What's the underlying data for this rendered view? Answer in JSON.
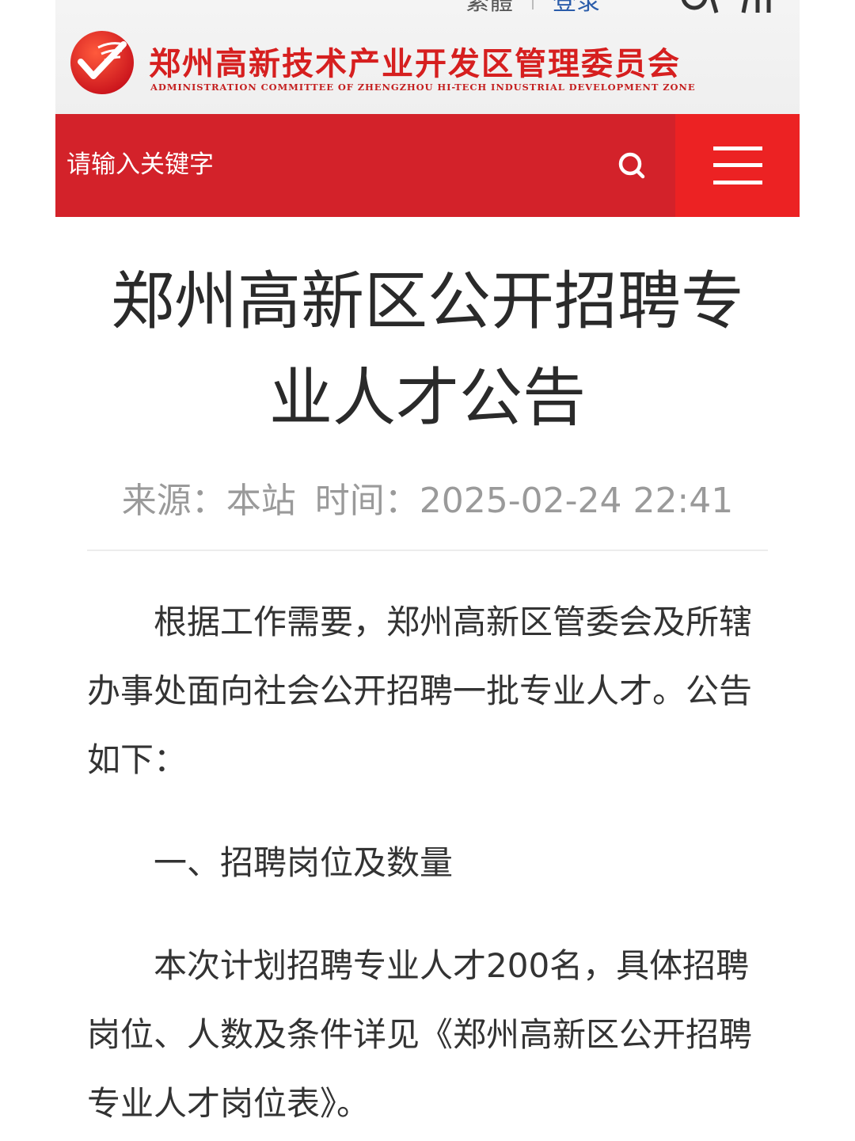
{
  "header": {
    "top_links": [
      "繁體",
      "登录"
    ],
    "icons": [
      "accessibility-icon",
      "elder-mode-icon"
    ],
    "logo_icon": "zhengzhou-hitech-logo",
    "org_name_cn": "郑州高新技术产业开发区管理委员会",
    "org_name_en": "ADMINISTRATION COMMITTEE OF ZHENGZHOU HI-TECH INDUSTRIAL DEVELOPMENT ZONE"
  },
  "search": {
    "placeholder": "请输入关键字",
    "search_icon": "search-icon",
    "menu_icon": "menu-icon"
  },
  "article": {
    "title": "郑州高新区公开招聘专业人才公告",
    "source_label": "来源：",
    "source": "本站",
    "time_label": "时间：",
    "time": "2025-02-24 22:41",
    "paragraphs": [
      "根据工作需要，郑州高新区管委会及所辖办事处面向社会公开招聘一批专业人才。公告如下：",
      "一、招聘岗位及数量",
      "本次计划招聘专业人才200名，具体招聘岗位、人数及条件详见《郑州高新区公开招聘专业人才岗位表》。"
    ]
  },
  "colors": {
    "search_bar": "#d3222a",
    "menu_button": "#ec2223",
    "brand_red": "#d61f1f"
  }
}
